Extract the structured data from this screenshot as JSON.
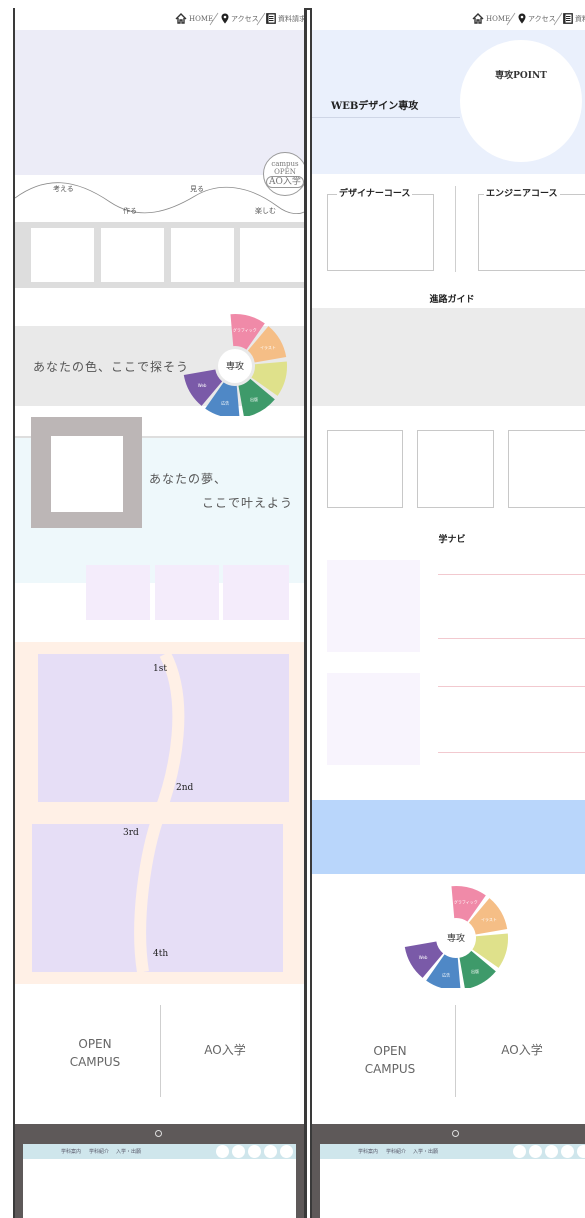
{
  "nav": {
    "home": "HOME",
    "access": "アクセス",
    "brochure": "資料請求"
  },
  "left": {
    "campus_badge": {
      "line1": "campus",
      "line2": "OPEN",
      "line3": "AO入学"
    },
    "wave_words": [
      "考える",
      "作る",
      "見る",
      "楽しむ"
    ],
    "tagline": "あなたの色、ここで探そう",
    "dream_line1": "あなたの夢、",
    "dream_line2": "ここで叶えよう",
    "steps": [
      "1st",
      "2nd",
      "3rd",
      "4th"
    ],
    "open_campus_line1": "OPEN",
    "open_campus_line2": "CAMPUS",
    "ao": "AO入学"
  },
  "wheel": {
    "center": "専攻",
    "segments": [
      "グラフィック",
      "イラスト",
      "",
      "出版",
      "広告",
      "Web"
    ],
    "colors": [
      "#f08aa8",
      "#f5be86",
      "#dfe18b",
      "#3e9a6a",
      "#4f88c6",
      "#7a5aa8"
    ]
  },
  "right": {
    "major": "WEBデザイン専攻",
    "major_point": "専攻POINT",
    "designer_course": "デザイナーコース",
    "engineer_course": "エンジニアコース",
    "career_guide": "進路ガイド",
    "gakunavi": "学ナビ",
    "open_campus_line1": "OPEN",
    "open_campus_line2": "CAMPUS",
    "ao": "AO入学"
  },
  "footer": {
    "links": [
      "学科案内",
      "学科紹介",
      "入学・出願"
    ]
  },
  "colors": {
    "frame": "#3a3a3a",
    "hero_left": "#ececf7",
    "hero_right": "#eaf0fc",
    "gray_band": "#dddddd",
    "mint": "#eef8fb",
    "lilac": "#f4ecfb",
    "peach": "#fff0e6",
    "purple": "#e6def6",
    "blue_band": "#b9d6fb",
    "footer_dark": "#5e5959",
    "footer_bar": "#cfe6ec"
  }
}
